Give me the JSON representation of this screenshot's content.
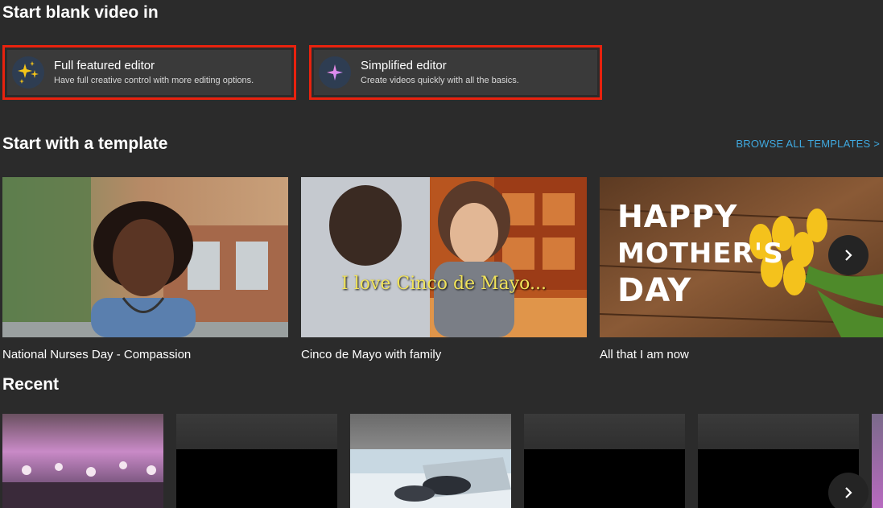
{
  "blank": {
    "title": "Start blank video in",
    "editors": [
      {
        "name": "Full featured editor",
        "description": "Have full creative control with more editing options.",
        "icon": "sparkles-icon"
      },
      {
        "name": "Simplified editor",
        "description": "Create videos quickly with all the basics.",
        "icon": "sparkle-icon"
      }
    ],
    "highlight_color": "#e8220e"
  },
  "templates": {
    "title": "Start with a template",
    "browse_label": "BROWSE ALL TEMPLATES >",
    "link_color": "#3fa9e0",
    "items": [
      {
        "label": "National Nurses Day - Compassion"
      },
      {
        "label": "Cinco de Mayo with family",
        "overlay_text": "I love Cinco de Mayo..."
      },
      {
        "label": "All that I am now",
        "overlay_lines": [
          "HAPPY",
          "MOTHER'S",
          "DAY"
        ]
      }
    ]
  },
  "recent": {
    "title": "Recent",
    "count_visible": 6
  }
}
